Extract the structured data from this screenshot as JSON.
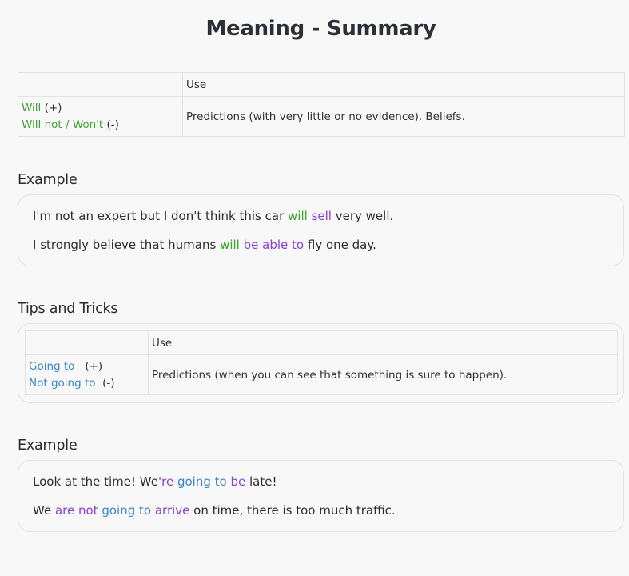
{
  "title": "Meaning - Summary",
  "table1": {
    "header": "Use",
    "form_positive": "Will",
    "form_positive_sign": " (+)",
    "form_negative": "Will not / Won't",
    "form_negative_sign": " (-)",
    "use": "Predictions (with very little or no evidence). Beliefs."
  },
  "example1": {
    "heading": "Example",
    "s1": {
      "a": "I'm not an expert but I don't think this car ",
      "b": "will",
      "c": " ",
      "d": "sell",
      "e": " very well."
    },
    "s2": {
      "a": "I strongly believe that humans ",
      "b": "will",
      "c": " ",
      "d": "be able to",
      "e": " fly one day."
    }
  },
  "tips": {
    "heading": "Tips and Tricks",
    "header": "Use",
    "form_positive": "Going to",
    "form_positive_sign": "   (+)",
    "form_negative": "Not going to",
    "form_negative_sign": "  (-)",
    "use": "Predictions (when you can see that something is sure to happen)."
  },
  "example2": {
    "heading": "Example",
    "s1": {
      "a": "Look at the time! We",
      "b": "'re",
      "c": " ",
      "d": "going to",
      "e": " ",
      "f": "be",
      "g": " late!"
    },
    "s2": {
      "a": "We ",
      "b": "are not",
      "c": " ",
      "d": "going to",
      "e": " ",
      "f": "arrive",
      "g": " on time, there is too much traffic."
    }
  },
  "colors": {
    "will": "#3da32d",
    "verb": "#8a3fd0",
    "going_to": "#3b86c8"
  }
}
